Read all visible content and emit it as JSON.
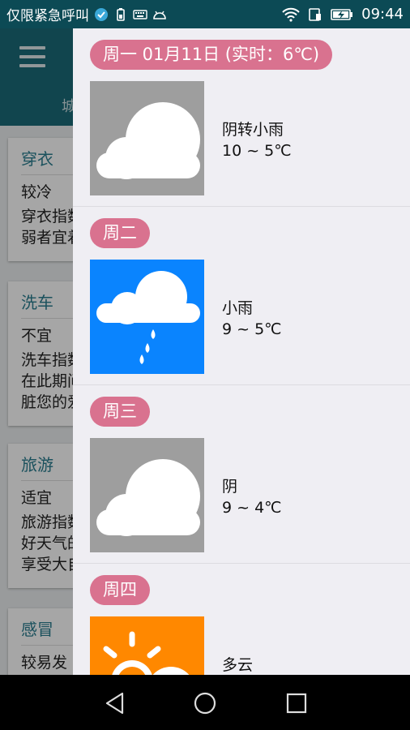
{
  "status_bar": {
    "carrier": "仅限紧急呼叫",
    "time": "09:44"
  },
  "app": {
    "subtitle": "城",
    "cards": [
      {
        "title": "穿衣",
        "lines": [
          "较冷",
          "穿衣指数",
          "弱者宜着"
        ]
      },
      {
        "title": "洗车",
        "lines": [
          "不宜",
          "洗车指数",
          "在此期间",
          "脏您的爱"
        ]
      },
      {
        "title": "旅游",
        "lines": [
          "适宜",
          "旅游指数",
          "好天气的",
          "享受大自"
        ]
      },
      {
        "title": "感冒",
        "lines": [
          "较易发"
        ]
      }
    ]
  },
  "forecast": {
    "days": [
      {
        "label": "周一 01月11日 (实时：6℃)",
        "condition": "阴转小雨",
        "temp": "10 ~ 5℃",
        "icon": "cloudy-icon",
        "bg": "#9e9e9e"
      },
      {
        "label": "周二",
        "condition": "小雨",
        "temp": "9 ~ 5℃",
        "icon": "light-rain-icon",
        "bg": "#0a84fe"
      },
      {
        "label": "周三",
        "condition": "阴",
        "temp": "9 ~ 4℃",
        "icon": "cloudy-icon",
        "bg": "#9e9e9e"
      },
      {
        "label": "周四",
        "condition": "多云",
        "temp": "",
        "icon": "partly-cloudy-icon",
        "bg": "#ff8800"
      }
    ]
  },
  "colors": {
    "status_bar": "#0c4a55",
    "app_bar": "#1b6a78",
    "pill": "#d9728f",
    "drawer_bg": "#efeef3"
  }
}
